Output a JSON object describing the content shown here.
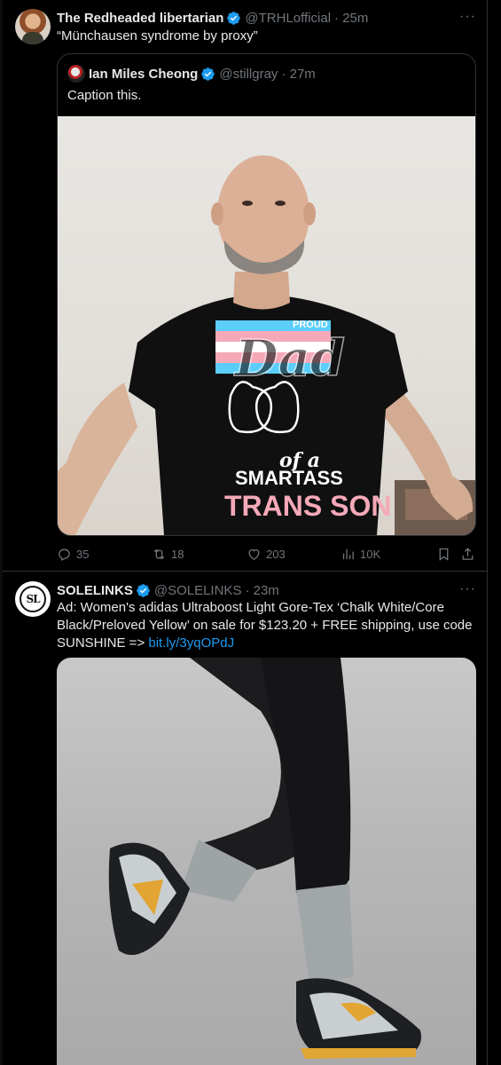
{
  "tweets": [
    {
      "author_name": "The Redheaded libertarian",
      "handle": "@TRHLofficial",
      "time": "· 25m",
      "text": "“Münchausen syndrome by proxy”",
      "quote": {
        "author_name": "Ian Miles Cheong",
        "handle": "@stillgray",
        "time": "· 27m",
        "text": "Caption this.",
        "image_text": {
          "line1": "PROUD",
          "line2": "Dad",
          "line3": "of a",
          "line4": "SMARTASS",
          "line5": "TRANS SON"
        }
      },
      "stats": {
        "replies": "35",
        "reposts": "18",
        "likes": "203",
        "views": "10K"
      }
    },
    {
      "author_name": "SOLELINKS",
      "handle": "@SOLELINKS",
      "time": "· 23m",
      "avatar_text": "SL",
      "text_line1": "Ad: Women's adidas Ultraboost Light Gore-Tex ‘Chalk White/Core",
      "text_line2": "Black/Preloved Yellow’ on sale for $123.20 + FREE shipping, use code",
      "text_line3_prefix": "SUNSHINE => ",
      "link": "bit.ly/3yqOPdJ"
    }
  ],
  "icons": {
    "more": "more-dots-icon",
    "verified": "verified-badge-icon",
    "reply": "reply-icon",
    "repost": "repost-icon",
    "like": "heart-icon",
    "views": "views-icon",
    "bookmark": "bookmark-icon",
    "share": "share-icon"
  },
  "colors": {
    "background": "#000000",
    "text": "#e7e9ea",
    "muted": "#71767b",
    "accent": "#1d9bf0",
    "border": "#2f3336"
  }
}
